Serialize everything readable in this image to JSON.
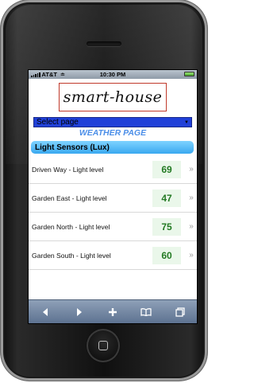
{
  "status": {
    "carrier": "AT&T",
    "time": "10:30 PM"
  },
  "logo": {
    "text": "smart-house"
  },
  "page_select": {
    "value": "Select page"
  },
  "page_title": "WEATHER PAGE",
  "section": {
    "title": "Light Sensors (Lux)"
  },
  "sensors": [
    {
      "label": "Driven Way - Light level",
      "value": "69"
    },
    {
      "label": "Garden East - Light level",
      "value": "47"
    },
    {
      "label": "Garden North - Light level",
      "value": "75"
    },
    {
      "label": "Garden South - Light level",
      "value": "60"
    }
  ],
  "colors": {
    "select_bg": "#2040d8",
    "accent": "#4b8ee8",
    "header": "#3aa8f0",
    "value_text": "#237a23"
  }
}
